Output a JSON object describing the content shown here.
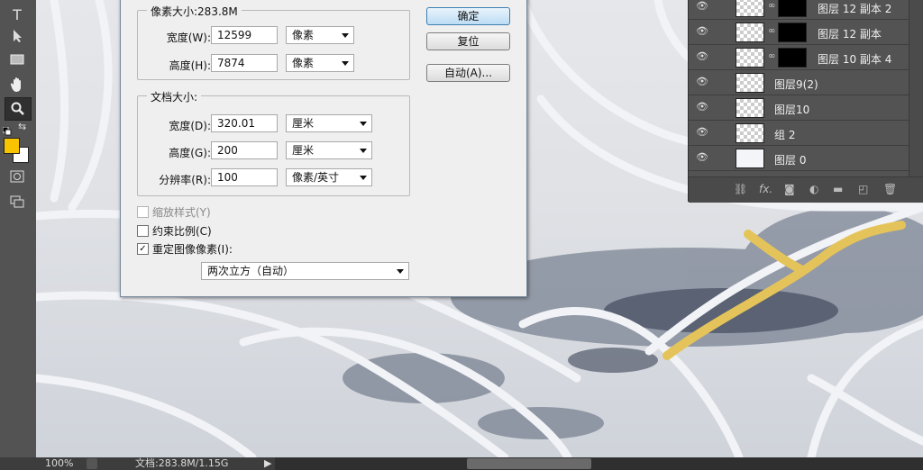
{
  "toolbar": {
    "tools": [
      "type-tool",
      "path-selection-tool",
      "rectangle-tool",
      "hand-tool",
      "zoom-tool",
      "quick-mask",
      "screen-mode"
    ],
    "type_glyph": "T",
    "fg_color": "#f8c400",
    "bg_color": "#ffffff"
  },
  "dialog": {
    "pixel_size": {
      "legend": "像素大小:283.8M",
      "width_label": "宽度(W):",
      "width_value": "12599",
      "width_unit": "像素",
      "height_label": "高度(H):",
      "height_value": "7874",
      "height_unit": "像素"
    },
    "doc_size": {
      "legend": "文档大小:",
      "width_label": "宽度(D):",
      "width_value": "320.01",
      "width_unit": "厘米",
      "height_label": "高度(G):",
      "height_value": "200",
      "height_unit": "厘米",
      "res_label": "分辨率(R):",
      "res_value": "100",
      "res_unit": "像素/英寸"
    },
    "checkboxes": {
      "scale_styles": "缩放样式(Y)",
      "constrain": "约束比例(C)",
      "resample": "重定图像像素(I):",
      "resample_mark": "✓"
    },
    "resample_method": "两次立方（自动）",
    "buttons": {
      "ok": "确定",
      "reset": "复位",
      "auto": "自动(A)..."
    }
  },
  "layers": {
    "rows": [
      {
        "name": "图层 12 副本 2",
        "has_mask": true
      },
      {
        "name": "图层 12 副本",
        "has_mask": true
      },
      {
        "name": "图层 10 副本 4",
        "has_mask": true
      },
      {
        "name": "图层9(2)",
        "has_mask": false
      },
      {
        "name": "图层10",
        "has_mask": false
      },
      {
        "name": "组 2",
        "has_mask": false
      },
      {
        "name": "图层 0",
        "has_mask": false
      }
    ],
    "footer_icons": [
      "link-icon",
      "fx-icon",
      "mask-icon",
      "adjustment-icon",
      "folder-icon",
      "new-layer-icon",
      "trash-icon"
    ],
    "fx_label": "fx."
  },
  "status": {
    "zoom": "100%",
    "doc_info": "文档:283.8M/1.15G"
  }
}
